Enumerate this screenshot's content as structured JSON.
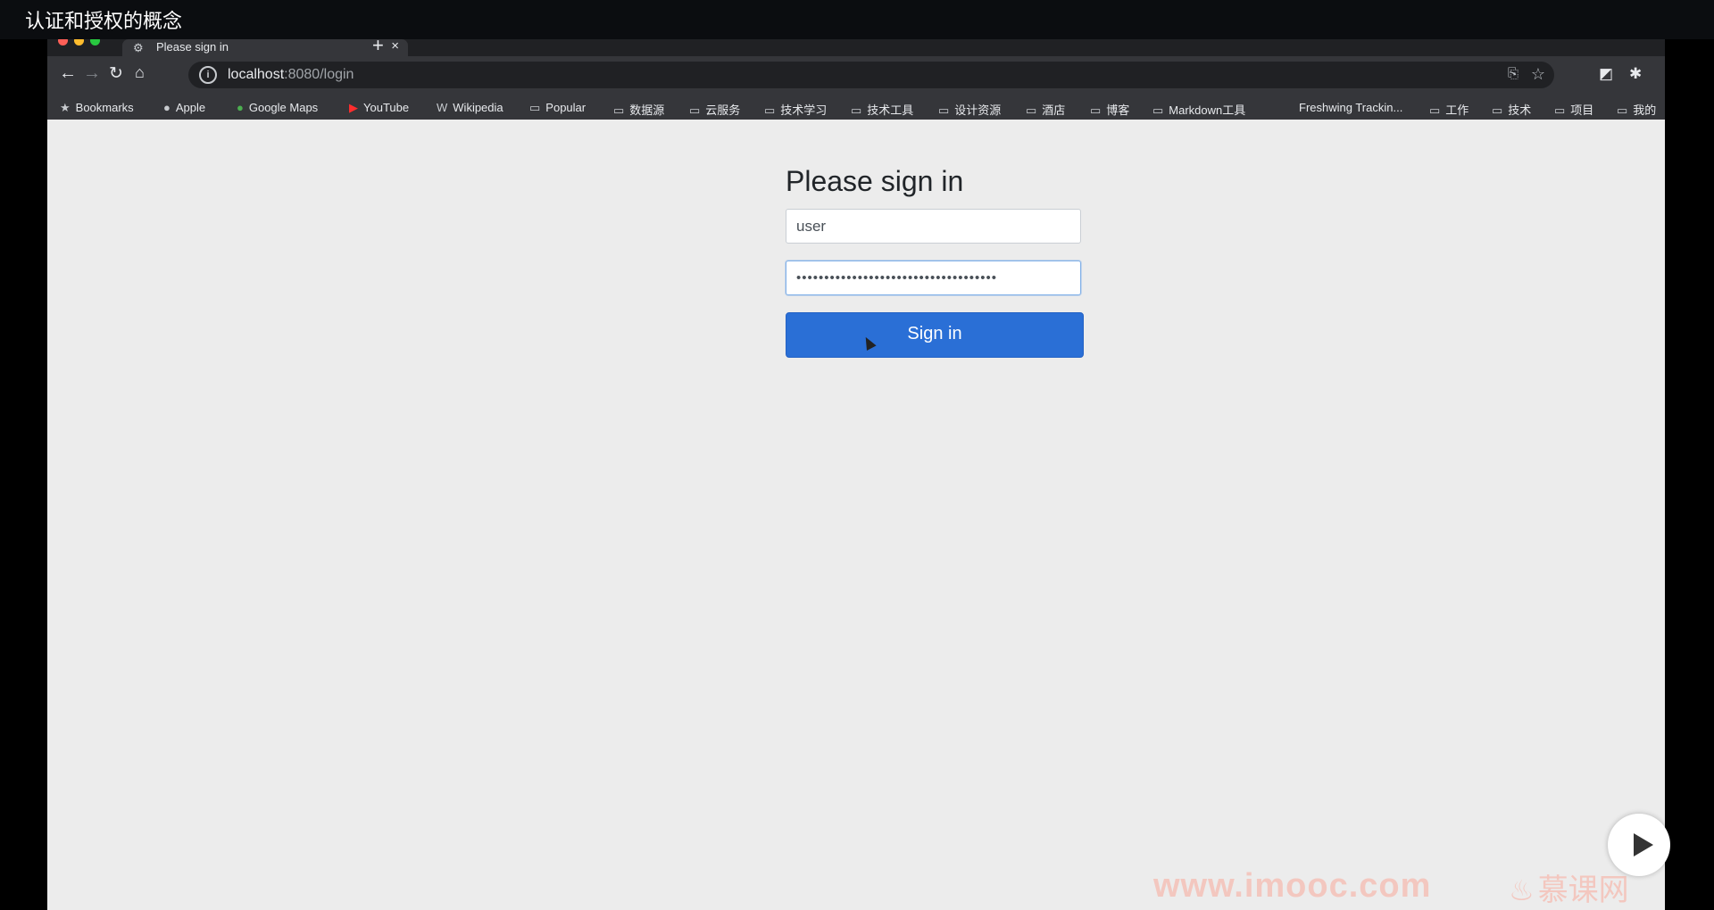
{
  "video": {
    "title": "认证和授权的概念"
  },
  "browser": {
    "tab": {
      "title": "Please sign in",
      "close_glyph": "×",
      "new_tab_glyph": "+"
    },
    "address": {
      "host": "localhost",
      "rest": ":8080/login"
    },
    "bookmarks": [
      {
        "label": "Bookmarks",
        "icon": "star-icon"
      },
      {
        "label": "Apple",
        "icon": "apple-icon"
      },
      {
        "label": "Google Maps",
        "icon": "map-pin-icon"
      },
      {
        "label": "YouTube",
        "icon": "youtube-icon"
      },
      {
        "label": "Wikipedia",
        "icon": "wikipedia-icon"
      },
      {
        "label": "Popular",
        "icon": "folder-icon"
      },
      {
        "label": "数据源",
        "icon": "folder-icon"
      },
      {
        "label": "云服务",
        "icon": "folder-icon"
      },
      {
        "label": "技术学习",
        "icon": "folder-icon"
      },
      {
        "label": "技术工具",
        "icon": "folder-icon"
      },
      {
        "label": "设计资源",
        "icon": "folder-icon"
      },
      {
        "label": "酒店",
        "icon": "folder-icon"
      },
      {
        "label": "博客",
        "icon": "folder-icon"
      },
      {
        "label": "Markdown工具",
        "icon": "folder-icon"
      },
      {
        "label": "Freshwing Trackin...",
        "icon": "none"
      },
      {
        "label": "工作",
        "icon": "folder-icon"
      },
      {
        "label": "技术",
        "icon": "folder-icon"
      },
      {
        "label": "项目",
        "icon": "folder-icon"
      },
      {
        "label": "我的",
        "icon": "folder-icon"
      }
    ]
  },
  "login": {
    "title": "Please sign in",
    "username": "user",
    "password_masked": "••••••••••••••••••••••••••••••••••••",
    "button": "Sign in"
  },
  "watermark": {
    "url": "www.imooc.com",
    "brand": "慕课网"
  },
  "colors": {
    "accent": "#2a6fd6",
    "page_bg": "#ececec",
    "chrome_dark": "#35363a"
  }
}
